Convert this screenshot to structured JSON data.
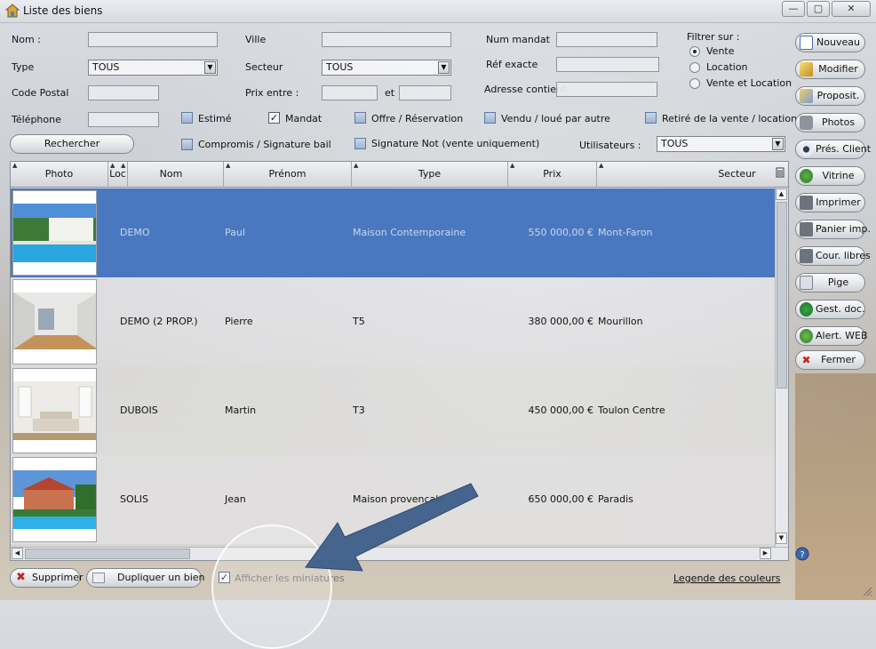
{
  "window": {
    "title": "Liste des biens",
    "controls": {
      "minimize": "—",
      "maximize": "▢",
      "close": "✕"
    }
  },
  "filters": {
    "nom_label": "Nom :",
    "ville_label": "Ville",
    "num_mandat_label": "Num mandat",
    "type_label": "Type",
    "type_value": "TOUS",
    "secteur_label": "Secteur",
    "secteur_value": "TOUS",
    "ref_exacte_label": "Réf exacte",
    "code_postal_label": "Code Postal",
    "prix_entre_label": "Prix entre :",
    "et_label": "et",
    "adresse_label": "Adresse contient",
    "telephone_label": "Téléphone",
    "filtrer_label": "Filtrer sur :",
    "filtrer_options": [
      "Vente",
      "Location",
      "Vente et Location"
    ],
    "filtrer_selected": "Vente",
    "utilisateurs_label": "Utilisateurs :",
    "utilisateurs_value": "TOUS",
    "checkboxes": {
      "estime": {
        "label": "Estimé",
        "checked": false
      },
      "mandat": {
        "label": "Mandat",
        "checked": true
      },
      "offre": {
        "label": "Offre / Réservation",
        "checked": false
      },
      "vendu": {
        "label": "Vendu / loué par autre",
        "checked": false
      },
      "retire": {
        "label": "Retiré de la vente / location",
        "checked": false
      },
      "compromis": {
        "label": "Compromis / Signature bail",
        "checked": false
      },
      "signature": {
        "label": "Signature Not (vente uniquement)",
        "checked": false
      }
    },
    "search_button": "Rechercher"
  },
  "sidebar": {
    "buttons": [
      {
        "label": "Nouveau",
        "icon": "document-icon"
      },
      {
        "label": "Modifier",
        "icon": "edit-icon"
      },
      {
        "label": "Proposit.",
        "icon": "proposal-icon"
      },
      {
        "label": "Photos",
        "icon": "camera-icon"
      },
      {
        "label": "Prés. Client",
        "icon": "eye-icon"
      },
      {
        "label": "Vitrine",
        "icon": "globe-icon"
      },
      {
        "label": "Imprimer",
        "icon": "printer-icon"
      },
      {
        "label": "Panier imp.",
        "icon": "printer-icon"
      },
      {
        "label": "Cour. libres",
        "icon": "printer-icon"
      },
      {
        "label": "Pige",
        "icon": "newspaper-icon"
      },
      {
        "label": "Gest. doc.",
        "icon": "document-manager-icon"
      },
      {
        "label": "Alert. WEB",
        "icon": "alert-web-icon"
      },
      {
        "label": "Fermer",
        "icon": "close-icon"
      }
    ]
  },
  "grid": {
    "columns": [
      "Photo",
      "Loc",
      "Nom",
      "Prénom",
      "Type",
      "Prix",
      "Secteur"
    ],
    "rows": [
      {
        "nom": "DEMO",
        "prenom": "Paul",
        "type": "Maison Contemporaine",
        "prix": "550 000,00 €",
        "secteur": "Mont-Faron",
        "selected": true
      },
      {
        "nom": "DEMO (2 PROP.)",
        "prenom": "Pierre",
        "type": "T5",
        "prix": "380 000,00 €",
        "secteur": "Mourillon",
        "selected": false
      },
      {
        "nom": "DUBOIS",
        "prenom": "Martin",
        "type": "T3",
        "prix": "450 000,00 €",
        "secteur": "Toulon Centre",
        "selected": false
      },
      {
        "nom": "SOLIS",
        "prenom": "Jean",
        "type": "Maison provençale",
        "prix": "650 000,00 €",
        "secteur": "Paradis",
        "selected": false
      }
    ]
  },
  "footer": {
    "supprimer": "Supprimer",
    "dupliquer": "Dupliquer un bien",
    "miniatures_label": "Afficher les miniatures",
    "miniatures_checked": true,
    "legende": "Legende des couleurs"
  },
  "colors": {
    "selection": "#4a78c0",
    "accent_arrow": "#3e5f8a"
  }
}
